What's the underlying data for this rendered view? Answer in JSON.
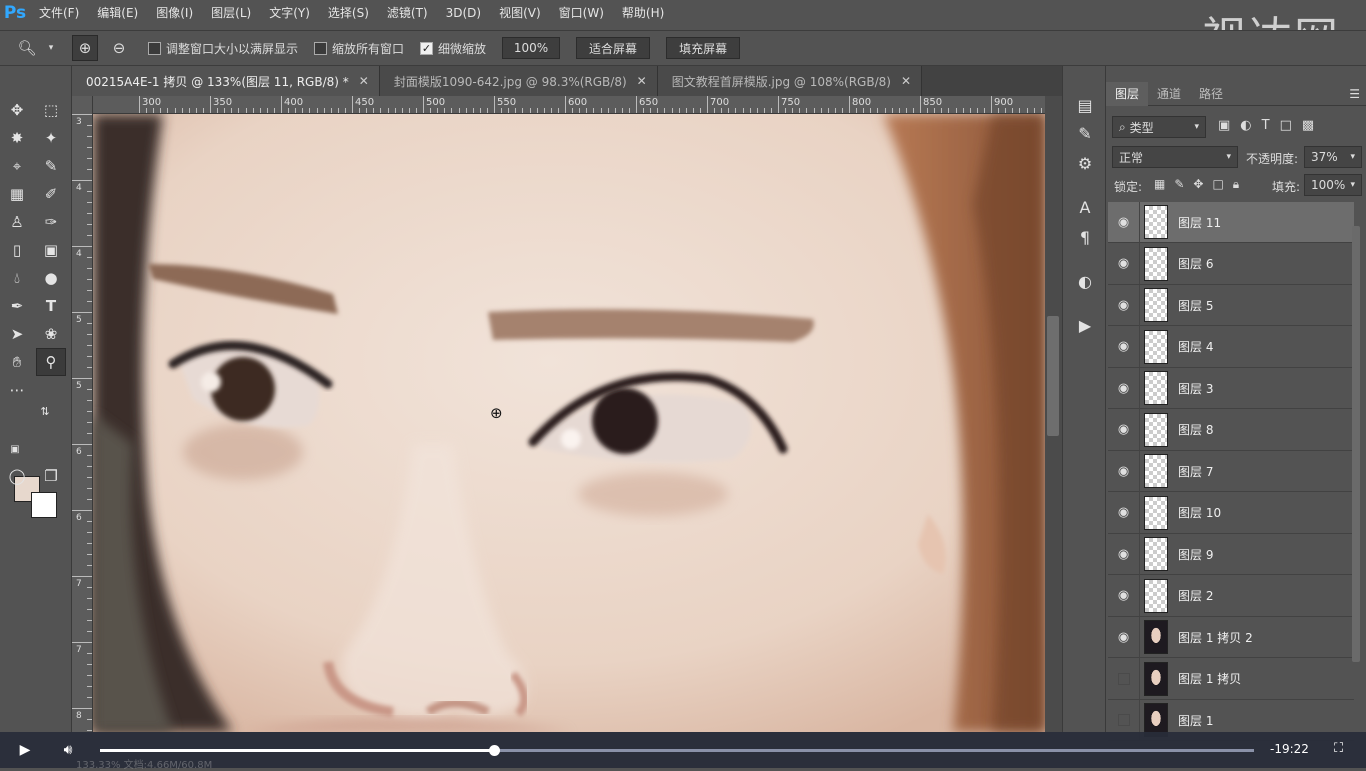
{
  "app": {
    "logo": "Ps"
  },
  "menu": [
    "文件(F)",
    "编辑(E)",
    "图像(I)",
    "图层(L)",
    "文字(Y)",
    "选择(S)",
    "滤镜(T)",
    "3D(D)",
    "视图(V)",
    "窗口(W)",
    "帮助(H)"
  ],
  "watermark": "视达网",
  "options": {
    "resize_windows_label": "调整窗口大小以满屏显示",
    "resize_windows_checked": false,
    "zoom_all_label": "缩放所有窗口",
    "zoom_all_checked": false,
    "scrubby_zoom_label": "细微缩放",
    "scrubby_zoom_checked": true,
    "zoom_value": "100%",
    "fit_screen_label": "适合屏幕",
    "fill_screen_label": "填充屏幕"
  },
  "tabs": [
    {
      "label": "00215A4E-1 拷贝 @ 133%(图层 11, RGB/8) *",
      "active": true
    },
    {
      "label": "封面模版1090-642.jpg @ 98.3%(RGB/8)",
      "active": false
    },
    {
      "label": "图文教程首屏模版.jpg @ 108%(RGB/8)",
      "active": false
    }
  ],
  "ruler_h": [
    "300",
    "350",
    "400",
    "450",
    "500",
    "550",
    "600",
    "650",
    "700",
    "750",
    "800",
    "850",
    "900"
  ],
  "ruler_v": [
    "3",
    "4",
    "4",
    "5",
    "5",
    "6",
    "6",
    "7",
    "7",
    "8"
  ],
  "colors": {
    "foreground": "#e7d8cd",
    "background": "#ffffff",
    "accent": "#31a8ff"
  },
  "layers_panel": {
    "tabs": [
      "图层",
      "通道",
      "路径"
    ],
    "filter_kind": "类型",
    "blend_mode": "正常",
    "opacity_label": "不透明度:",
    "opacity_value": "37%",
    "lock_label": "锁定:",
    "fill_label": "填充:",
    "fill_value": "100%",
    "layers": [
      {
        "name": "图层 11",
        "visible": true,
        "selected": true,
        "thumb": "transparent"
      },
      {
        "name": "图层 6",
        "visible": true,
        "selected": false,
        "thumb": "transparent"
      },
      {
        "name": "图层 5",
        "visible": true,
        "selected": false,
        "thumb": "transparent"
      },
      {
        "name": "图层 4",
        "visible": true,
        "selected": false,
        "thumb": "transparent"
      },
      {
        "name": "图层 3",
        "visible": true,
        "selected": false,
        "thumb": "transparent"
      },
      {
        "name": "图层 8",
        "visible": true,
        "selected": false,
        "thumb": "transparent"
      },
      {
        "name": "图层 7",
        "visible": true,
        "selected": false,
        "thumb": "transparent"
      },
      {
        "name": "图层 10",
        "visible": true,
        "selected": false,
        "thumb": "transparent"
      },
      {
        "name": "图层 9",
        "visible": true,
        "selected": false,
        "thumb": "transparent"
      },
      {
        "name": "图层 2",
        "visible": true,
        "selected": false,
        "thumb": "transparent"
      },
      {
        "name": "图层 1 拷贝 2",
        "visible": true,
        "selected": false,
        "thumb": "photo"
      },
      {
        "name": "图层 1 拷贝",
        "visible": false,
        "selected": false,
        "thumb": "photo"
      },
      {
        "name": "图层 1",
        "visible": false,
        "selected": false,
        "thumb": "photo"
      }
    ]
  },
  "video": {
    "time": "-19:22",
    "progress": 0.341
  },
  "status_ghost": "133.33%      文档:4.66M/60.8M"
}
